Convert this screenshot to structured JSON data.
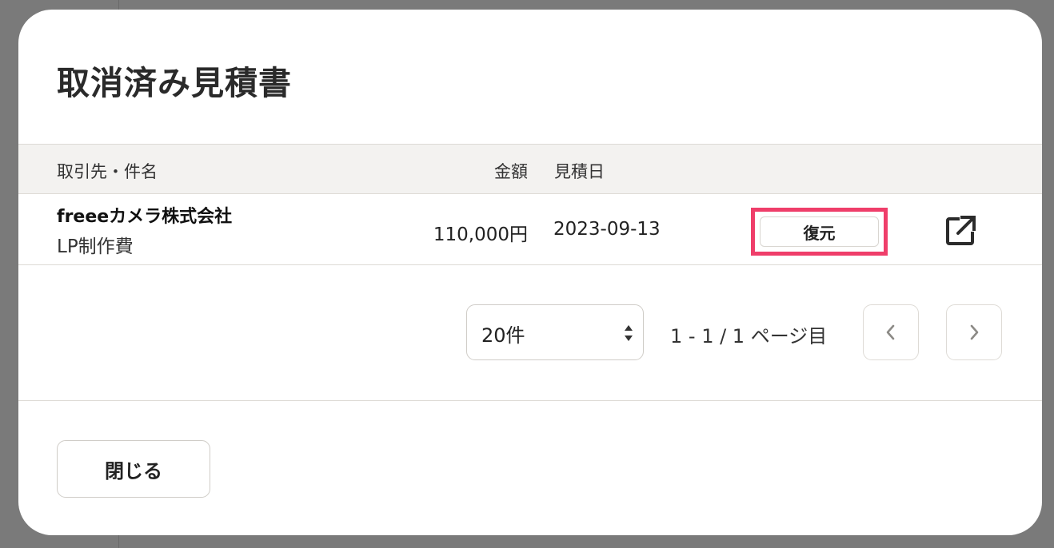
{
  "modal": {
    "title": "取消済み見積書"
  },
  "table": {
    "headers": {
      "party": "取引先・件名",
      "amount": "金額",
      "date": "見積日"
    },
    "rows": [
      {
        "party": "freeeカメラ株式会社",
        "subject": "LP制作費",
        "amount": "110,000円",
        "date": "2023-09-13",
        "restore_label": "復元",
        "external_link_icon": "external-link-icon"
      }
    ]
  },
  "pagination": {
    "per_page": "20件",
    "page_info": "1 - 1 / 1 ページ目",
    "prev_icon": "chevron-left-icon",
    "next_icon": "chevron-right-icon"
  },
  "footer": {
    "close_label": "閉じる"
  },
  "colors": {
    "highlight": "#ef3e6a",
    "header_bg": "#f3f2f0",
    "overlay": "#7a7a7a"
  }
}
